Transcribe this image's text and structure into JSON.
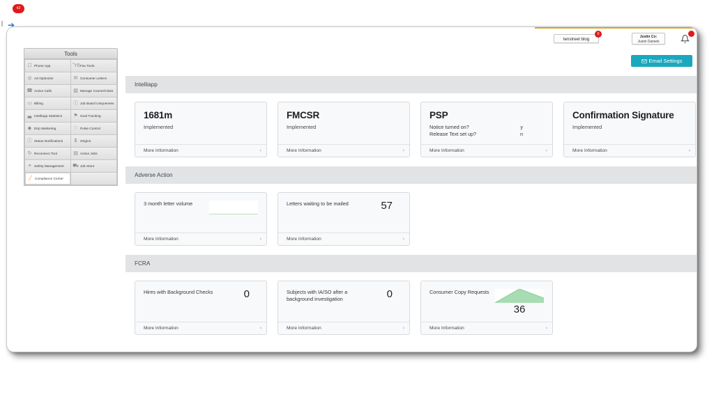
{
  "header": {
    "blog_chip": "tenstreet blog",
    "blog_badge": "0",
    "user_company": "Justin Co:",
    "user_name": "Justin Daniels",
    "bell_icon": "bell-icon",
    "email_settings_label": "Email Settings",
    "email_settings_icon": "envelope-icon",
    "corner_badge": "42",
    "accent_teal": "#1aa8bd",
    "accent_red": "#e01b1b",
    "accent_gold": "#d8a82a"
  },
  "sidebar": {
    "title": "Tools",
    "items": [
      {
        "label": "Phone App",
        "icon": "phone-app-icon",
        "selected": false
      },
      {
        "label": "Fax Tools",
        "icon": "fax-icon",
        "selected": false
      },
      {
        "label": "Ad Optimizer",
        "icon": "target-icon",
        "selected": false
      },
      {
        "label": "Consumer Letters",
        "icon": "envelope-icon",
        "selected": false
      },
      {
        "label": "Active Calls",
        "icon": "phone-icon",
        "selected": false
      },
      {
        "label": "Manage Course/Class",
        "icon": "document-icon",
        "selected": false
      },
      {
        "label": "Billing",
        "icon": "credit-card-icon",
        "selected": false
      },
      {
        "label": "Job Board Uniqueness",
        "icon": "info-circle-icon",
        "selected": false
      },
      {
        "label": "Intelliapp Statistics",
        "icon": "bar-chart-icon",
        "selected": false
      },
      {
        "label": "Goal Tracking",
        "icon": "flag-icon",
        "selected": false
      },
      {
        "label": "Drip Marketing",
        "icon": "droplet-icon",
        "selected": false
      },
      {
        "label": "Pulse Control",
        "icon": "heart-icon",
        "selected": false
      },
      {
        "label": "Status Notifications",
        "icon": "alert-circle-icon",
        "selected": false
      },
      {
        "label": "Origins",
        "icon": "dollar-icon",
        "selected": false
      },
      {
        "label": "Reconnect Tool",
        "icon": "refresh-icon",
        "selected": false
      },
      {
        "label": "Active Jobs",
        "icon": "briefcase-icon",
        "selected": false
      },
      {
        "label": "Safety Management",
        "icon": "sliders-icon",
        "selected": false
      },
      {
        "label": "Job Store",
        "icon": "cart-icon",
        "selected": false
      },
      {
        "label": "Compliance Center",
        "icon": "pencil-icon",
        "selected": true
      }
    ]
  },
  "sections": [
    {
      "title": "Intelliapp",
      "cards": [
        {
          "kind": "headline",
          "headline": "1681m",
          "subtext": "Implemented",
          "footer": "More Information"
        },
        {
          "kind": "headline",
          "headline": "FMCSR",
          "subtext": "Implemented",
          "footer": "More Information"
        },
        {
          "kind": "keyvalue",
          "headline": "PSP",
          "rows": [
            {
              "key": "Notice turned on?",
              "value": "y"
            },
            {
              "key": "Release Text set up?",
              "value": "n"
            }
          ],
          "footer": "More Information"
        },
        {
          "kind": "headline",
          "headline": "Confirmation Signature",
          "subtext": "Implemented",
          "footer": "More Information"
        }
      ]
    },
    {
      "title": "Adverse Action",
      "cards": [
        {
          "kind": "sparkline",
          "label": "3 month letter volume",
          "chart_ref": 0,
          "footer": "More Information"
        },
        {
          "kind": "metric",
          "label": "Letters waiting to be mailed",
          "value": "57",
          "footer": "More Information"
        }
      ]
    },
    {
      "title": "FCRA",
      "cards": [
        {
          "kind": "metric",
          "label": "Hires with Background Checks",
          "value": "0",
          "footer": "More Information"
        },
        {
          "kind": "metric",
          "label": "Subjects with IA/SO after a background investigation",
          "value": "0",
          "footer": "More Information"
        },
        {
          "kind": "sparkline",
          "label": "Consumer Copy Requests",
          "value": "36",
          "chart_ref": 1,
          "footer": "More Information"
        }
      ]
    }
  ],
  "chart_data": [
    {
      "type": "area",
      "title": "3 month letter volume",
      "x": [
        0,
        1,
        2
      ],
      "values": [
        0,
        0,
        0
      ],
      "ylim": [
        0,
        1
      ],
      "series_color": "#8fd49a",
      "fill_color": "#cfe9d4",
      "grid": false,
      "legend": "none",
      "xlabel": "",
      "ylabel": ""
    },
    {
      "type": "area",
      "title": "Consumer Copy Requests",
      "x": [
        0,
        1,
        2
      ],
      "values": [
        0,
        36,
        12
      ],
      "ylim": [
        0,
        36
      ],
      "data_label": "36",
      "series_color": "#8fd49a",
      "fill_color": "#a8dcb2",
      "grid": false,
      "legend": "none",
      "xlabel": "",
      "ylabel": ""
    }
  ]
}
